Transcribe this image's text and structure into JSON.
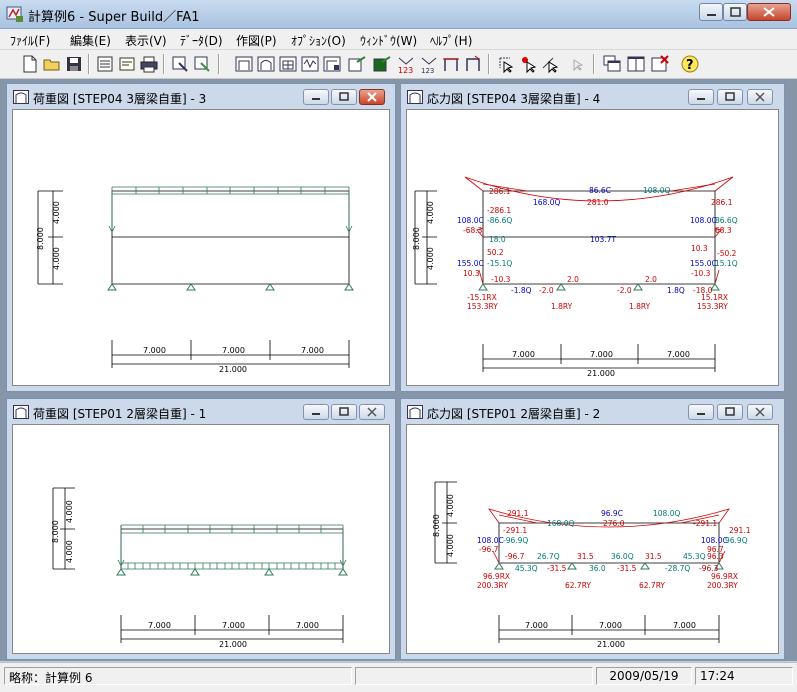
{
  "window": {
    "title": "計算例6 - Super Build／FA1"
  },
  "menu": [
    {
      "label": "ﾌｧｲﾙ(F)"
    },
    {
      "label": "編集(E)"
    },
    {
      "label": "表示(V)"
    },
    {
      "label": "ﾃﾞｰﾀ(D)"
    },
    {
      "label": "作図(P)"
    },
    {
      "label": "ｵﾌﾟｼｮﾝ(O)"
    },
    {
      "label": "ｳｨﾝﾄﾞｳ(W)"
    },
    {
      "label": "ﾍﾙﾌﾟ(H)"
    }
  ],
  "toolbar": {
    "icons": [
      "new-file-icon",
      "open-folder-icon",
      "save-icon",
      "list-icon",
      "report-icon",
      "print-icon",
      "zoom-in-icon",
      "zoom-out-icon",
      "frame-icon",
      "frame-arch-icon",
      "frame-grid-icon",
      "waveform-icon",
      "frame-edit-icon",
      "frame-export-icon",
      "frame-import-icon",
      "number-123-icon",
      "number-123b-icon",
      "frame-top-icon",
      "frame-top2-icon",
      "select-cursor-icon",
      "pointer-red-icon",
      "pointer-load-icon",
      "pointer-disabled-icon",
      "cascade-windows-icon",
      "tile-windows-icon",
      "close-windows-icon",
      "help-icon"
    ]
  },
  "windows": [
    {
      "title": "荷重図 [STEP04 3層梁自重] - 3"
    },
    {
      "title": "応力図 [STEP04 3層梁自重] - 4"
    },
    {
      "title": "荷重図 [STEP01 2層梁自重] - 1"
    },
    {
      "title": "応力図 [STEP01 2層梁自重] - 2"
    }
  ],
  "load3": {
    "dims": {
      "h_total": "8.000",
      "h1": "4.000",
      "h2": "4.000",
      "spans": [
        "7.000",
        "7.000",
        "7.000"
      ],
      "total": "21.000"
    }
  },
  "stress4": {
    "dims": {
      "h_total": "8.000",
      "h1": "4.000",
      "h2": "4.000",
      "spans": [
        "7.000",
        "7.000",
        "7.000"
      ],
      "total": "21.000"
    },
    "red": [
      "286.1",
      "281.0",
      "-286.1",
      "286.1",
      "-68.3",
      "68.3",
      "50.2",
      "-50.2",
      "10.3",
      "-10.3",
      "-10.3",
      "2.0",
      "2.0",
      "-2.0",
      "-2.0",
      "-15.1RX",
      "153.3RY",
      "1.8RY",
      "1.8RY",
      "15.1RX",
      "153.3RY",
      "-18.0",
      "10.3"
    ],
    "blue": [
      "86.6C",
      "108.0Q",
      "168.0Q",
      "108.0C",
      "-86.6Q",
      "108.0C",
      "86.6Q",
      "103.7T",
      "155.0C",
      "155.0C",
      "-1.8Q",
      "1.8Q"
    ],
    "teal": [
      "18.0",
      "-15.1Q",
      "15.1Q"
    ]
  },
  "load1": {
    "dims": {
      "h_total": "8.000",
      "h1": "4.000",
      "h2": "4.000",
      "spans": [
        "7.000",
        "7.000",
        "7.000"
      ],
      "total": "21.000"
    }
  },
  "stress2": {
    "dims": {
      "h_total": "8.000",
      "h1": "4.000",
      "h2": "4.000",
      "spans": [
        "7.000",
        "7.000",
        "7.000"
      ],
      "total": "21.000"
    },
    "red": [
      "291.1",
      "276.0",
      "-291.1",
      "291.1",
      "-96.7",
      "96.7",
      "31.5",
      "31.5",
      "-31.5",
      "-31.5",
      "-96.3",
      "96.3",
      "31.5",
      "96.9RX",
      "200.3RY",
      "62.7RY",
      "62.7RY",
      "96.9RX",
      "200.3RY",
      "45.3Q",
      "-45.3Q"
    ],
    "blue": [
      "96.9C",
      "108.0Q",
      "108.0C",
      "-96.9Q",
      "108.0C",
      "96.9Q",
      "168.0Q"
    ],
    "teal": [
      "26.7Q",
      "36.0Q",
      "26.7Q",
      "36.0",
      "-28.7Q",
      "45.3Q"
    ]
  },
  "status": {
    "abbr": "略称：計算例 6",
    "date": "2009/05/19",
    "time": "17:24"
  },
  "colors": {
    "red": "#d40000",
    "blue": "#0000cc",
    "teal": "#007a7a",
    "frame_green": "#2e7a5a"
  }
}
